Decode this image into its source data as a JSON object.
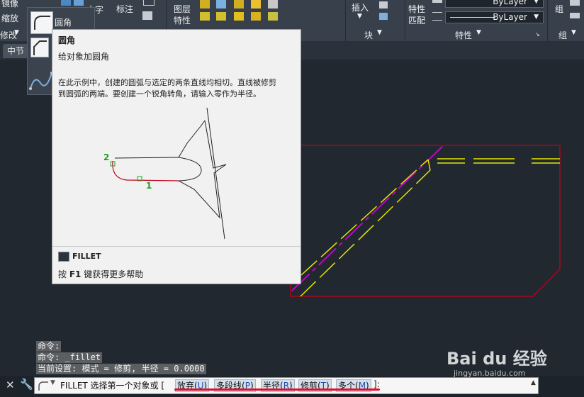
{
  "ribbon": {
    "modify_items": [
      "镜像",
      "缩放"
    ],
    "modify_panel": "修改",
    "text_label": "文字",
    "dim_label": "标注",
    "layer_label": "图层\n特性",
    "layer_line1": "图层",
    "layer_line2": "特性",
    "insert_label": "插入",
    "block_panel": "块",
    "props_line1": "特性",
    "props_line2": "匹配",
    "bylayer_1": "ByLayer",
    "bylayer_2": "ByLayer",
    "props_panel": "特性",
    "group_label": "组",
    "group_panel": "组"
  },
  "gallery": {
    "fillet_label": "圆角"
  },
  "tabs": {
    "active": "中节"
  },
  "tooltip": {
    "title": "圆角",
    "subtitle": "给对象加圆角",
    "desc_line1": "在此示例中，创建的圆弧与选定的两条直线均相切。直线被修剪",
    "desc_line2": "到圆弧的两端。要创建一个锐角转角，请输入零作为半径。",
    "marker_1": "1",
    "marker_2": "2",
    "command_name": "FILLET",
    "help_prefix": "按 ",
    "help_key": "F1",
    "help_suffix": " 键获得更多帮助"
  },
  "command_history": [
    "命令:",
    "命令: _fillet",
    "当前设置: 模式 = 修剪, 半径 = 0.0000"
  ],
  "command_line": {
    "prompt": "FILLET 选择第一个对象或 [",
    "options": [
      {
        "label": "放弃(",
        "key": "U",
        "end": ")"
      },
      {
        "label": "多段线(",
        "key": "P",
        "end": ")"
      },
      {
        "label": "半径(",
        "key": "R",
        "end": ")"
      },
      {
        "label": "修剪(",
        "key": "T",
        "end": ")"
      },
      {
        "label": "多个(",
        "key": "M",
        "end": ")"
      }
    ],
    "suffix": "]:"
  },
  "watermark": {
    "brand": "Bai du 经验",
    "url": "jingyan.baidu.com"
  },
  "colors": {
    "canvas_bg": "#212830",
    "ribbon_bg": "#38404b",
    "red_line": "#c0001a",
    "yellow_line": "#e6e600",
    "magenta_line": "#c800c8",
    "highlight_underline": "#e0102a"
  }
}
